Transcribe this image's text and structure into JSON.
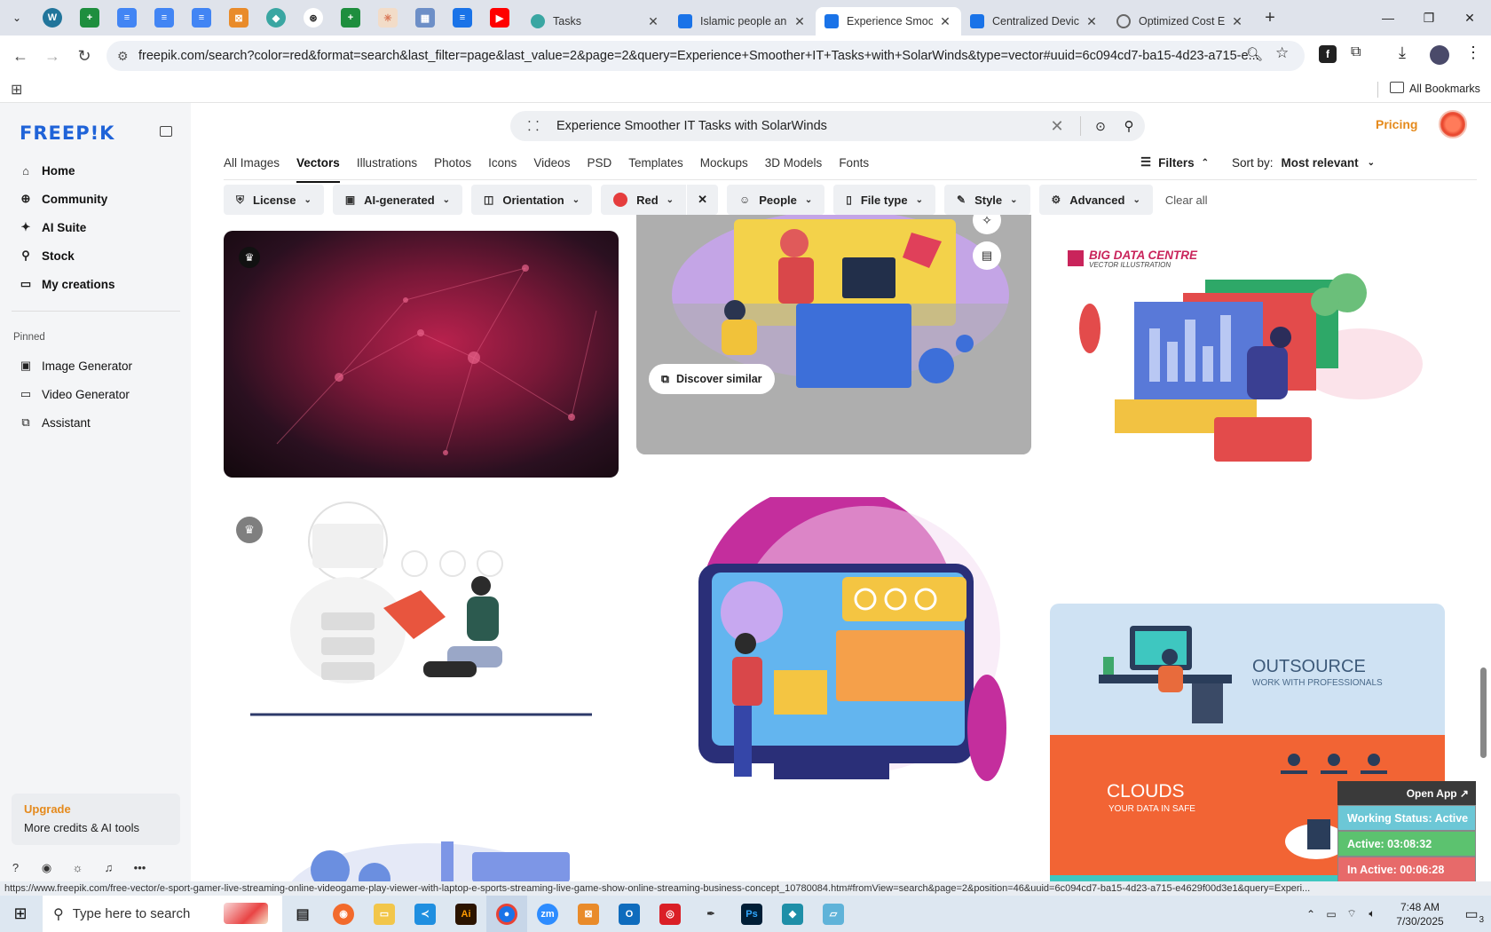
{
  "browser": {
    "tabs": [
      {
        "title": "Tasks",
        "icon_color": "#3aa6a2"
      },
      {
        "title": "Islamic people an",
        "icon_color": "#1a73e8"
      },
      {
        "title": "Experience Smoot",
        "icon_color": "#1a73e8",
        "active": true
      },
      {
        "title": "Centralized Devic",
        "icon_color": "#1a73e8"
      },
      {
        "title": "Optimized Cost E",
        "icon_color": "#666666"
      }
    ],
    "url": "freepik.com/search?color=red&format=search&last_filter=page&last_value=2&page=2&query=Experience+Smoother+IT+Tasks+with+SolarWinds&type=vector#uuid=6c094cd7-ba15-4d23-a715-e...",
    "bookmarks_label": "All Bookmarks"
  },
  "sidebar": {
    "logo": "FREEP!K",
    "items": [
      {
        "label": "Home",
        "icon": "home-icon"
      },
      {
        "label": "Community",
        "icon": "globe-icon"
      },
      {
        "label": "AI Suite",
        "icon": "sparkle-icon"
      },
      {
        "label": "Stock",
        "icon": "search-icon"
      },
      {
        "label": "My creations",
        "icon": "folder-icon"
      }
    ],
    "pinned_label": "Pinned",
    "pinned": [
      {
        "label": "Image Generator",
        "icon": "image-icon"
      },
      {
        "label": "Video Generator",
        "icon": "video-icon"
      },
      {
        "label": "Assistant",
        "icon": "chat-icon"
      }
    ],
    "upgrade_title": "Upgrade",
    "upgrade_sub": "More credits & AI tools"
  },
  "header": {
    "search_query": "Experience Smoother IT Tasks with SolarWinds",
    "pricing": "Pricing"
  },
  "category_tabs": [
    "All Images",
    "Vectors",
    "Illustrations",
    "Photos",
    "Icons",
    "Videos",
    "PSD",
    "Templates",
    "Mockups",
    "3D Models",
    "Fonts"
  ],
  "active_tab": "Vectors",
  "filters_label": "Filters",
  "sort_label": "Sort by:",
  "sort_value": "Most relevant",
  "chips": [
    {
      "label": "License",
      "icon": "license-icon"
    },
    {
      "label": "AI-generated",
      "icon": "ai-icon"
    },
    {
      "label": "Orientation",
      "icon": "orientation-icon"
    },
    {
      "label": "Red",
      "icon": "color-dot"
    },
    {
      "label": "People",
      "icon": "people-icon"
    },
    {
      "label": "File type",
      "icon": "file-icon"
    },
    {
      "label": "Style",
      "icon": "style-icon"
    },
    {
      "label": "Advanced",
      "icon": "gear-icon"
    }
  ],
  "clear_all": "Clear all",
  "results": {
    "discover_similar": "Discover similar",
    "big_data_title": "BIG DATA CENTRE",
    "big_data_sub": "VECTOR ILLUSTRATION",
    "outsource_title": "OUTSOURCE",
    "outsource_sub": "WORK WITH PROFESSIONALS",
    "clouds_title": "CLOUDS",
    "clouds_sub": "YOUR DATA IN SAFE"
  },
  "widget": {
    "open_app": "Open App ↗",
    "working_status": "Working Status: Active",
    "active": "Active: 03:08:32",
    "inactive": "In Active: 00:06:28"
  },
  "status_url": "https://www.freepik.com/free-vector/e-sport-gamer-live-streaming-online-videogame-play-viewer-with-laptop-e-sports-streaming-live-game-show-online-streaming-business-concept_10780084.htm#fromView=search&page=2&position=46&uuid=6c094cd7-ba15-4d23-a715-e4629f00d3e1&query=Experi...",
  "taskbar": {
    "search_placeholder": "Type here to search",
    "time": "7:48 AM",
    "date": "7/30/2025",
    "notif_count": "3"
  }
}
